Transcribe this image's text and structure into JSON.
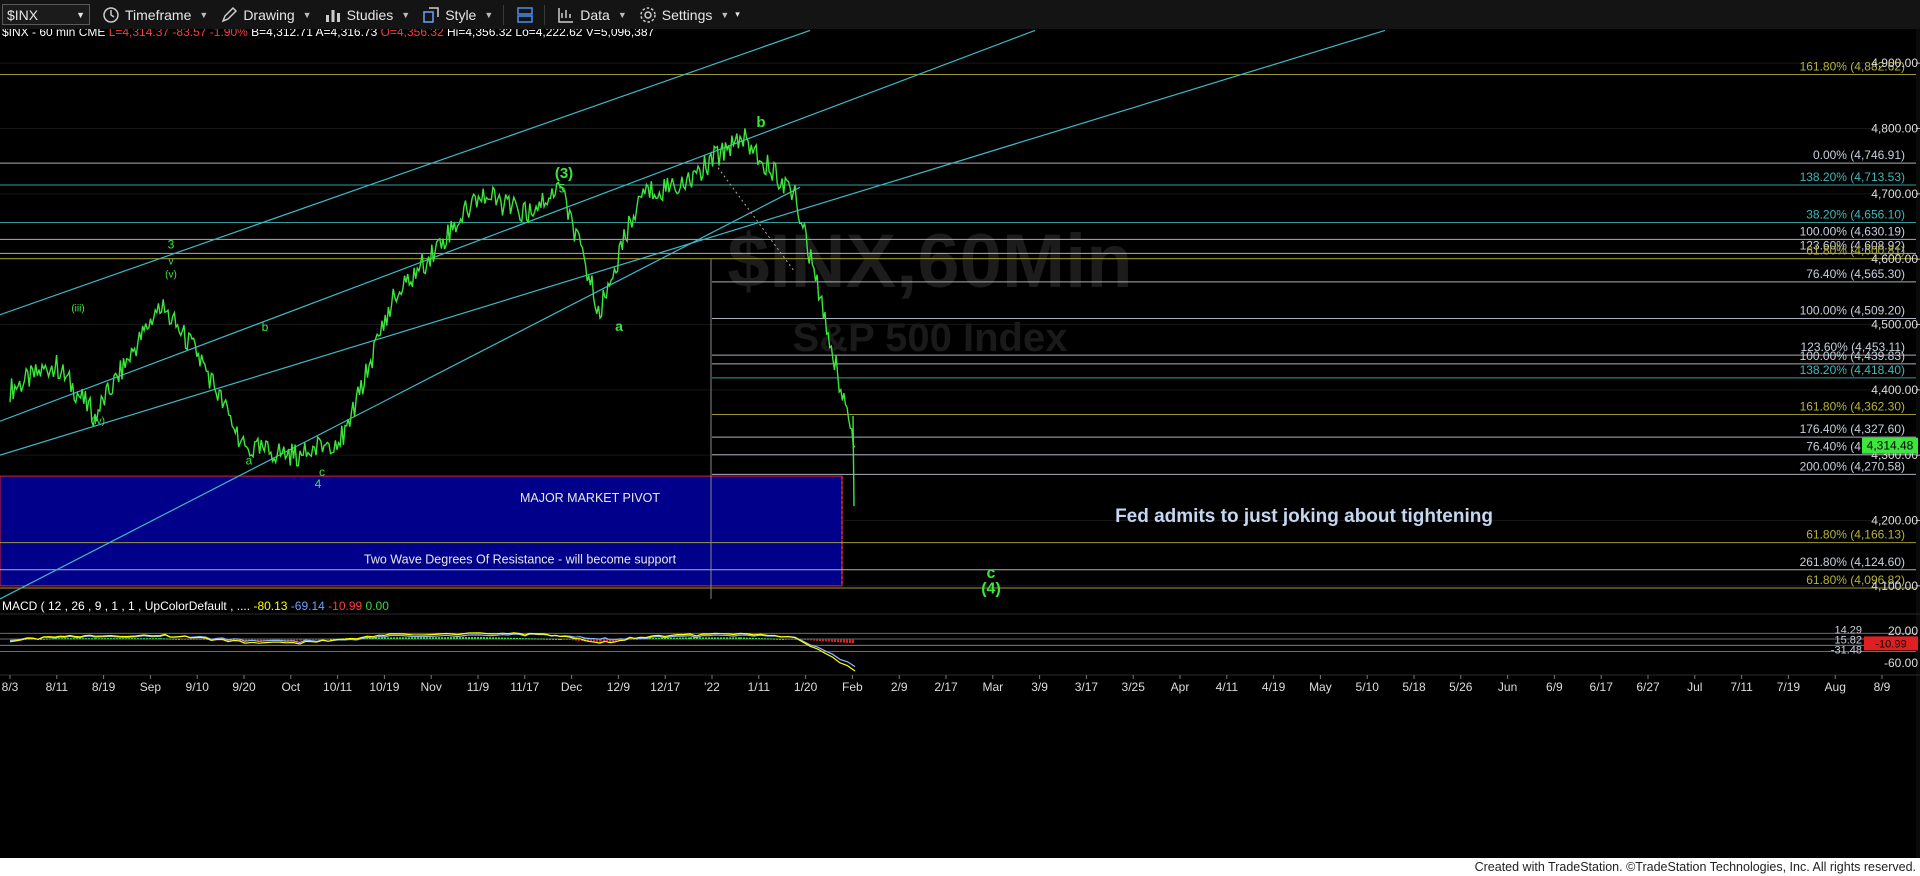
{
  "toolbar": {
    "symbol": "$INX",
    "timeframe_label": "Timeframe",
    "drawing_label": "Drawing",
    "studies_label": "Studies",
    "style_label": "Style",
    "data_label": "Data",
    "settings_label": "Settings"
  },
  "header_line": {
    "parts": [
      {
        "text": "$INX - 60 min  CME",
        "color": "#ffffff"
      },
      {
        "text": "L=4,314.37",
        "color": "#ff3b3b"
      },
      {
        "text": "-83.57",
        "color": "#ff3b3b"
      },
      {
        "text": "-1.90%",
        "color": "#ff3b3b"
      },
      {
        "text": "B=4,312.71",
        "color": "#ffffff"
      },
      {
        "text": "A=4,316.73",
        "color": "#ffffff"
      },
      {
        "text": "O=4,356.32",
        "color": "#ff3b3b"
      },
      {
        "text": "Hi=4,356.32",
        "color": "#ffffff"
      },
      {
        "text": "Lo=4,222.62",
        "color": "#ffffff"
      },
      {
        "text": "V=5,096,387",
        "color": "#ffffff"
      }
    ]
  },
  "watermark": {
    "symbol": "$INX,60Min",
    "name": "S&P 500 Index"
  },
  "annotation": "Fed admits to just joking about tightening",
  "pivot_box": {
    "title": "MAJOR MARKET PIVOT",
    "subtitle": "Two Wave Degrees Of Resistance - will become support"
  },
  "macd_header": {
    "parts": [
      {
        "text": "MACD ( 12 , 26 , 9 , 1 , 1 , UpColorDefault , ....",
        "color": "#ffffff"
      },
      {
        "text": "-80.13",
        "color": "#ffff00"
      },
      {
        "text": "-69.14",
        "color": "#6aa0ff"
      },
      {
        "text": "-10.99",
        "color": "#ff3b3b"
      },
      {
        "text": "0.00",
        "color": "#39d839"
      }
    ]
  },
  "footer": "Created with TradeStation. ©TradeStation Technologies, Inc. All rights reserved.",
  "chart_data": {
    "type": "line",
    "price_axis": {
      "range": [
        4060,
        4940
      ],
      "ticks": [
        4100,
        4200,
        4300,
        4400,
        4500,
        4600,
        4700,
        4800,
        4900
      ],
      "tick_labels": [
        "4,100.00",
        "4,200.00",
        "4,300.00",
        "4,400.00",
        "4,500.00",
        "4,600.00",
        "4,700.00",
        "4,800.00",
        "4,900.00"
      ]
    },
    "last_price": "4,314.48",
    "time_axis_labels": [
      "8/3",
      "8/11",
      "8/19",
      "Sep",
      "9/10",
      "9/20",
      "Oct",
      "10/11",
      "10/19",
      "Nov",
      "11/9",
      "11/17",
      "Dec",
      "12/9",
      "12/17",
      "'22",
      "1/11",
      "1/20",
      "Feb",
      "2/9",
      "2/17",
      "Mar",
      "3/9",
      "3/17",
      "3/25",
      "Apr",
      "4/11",
      "4/19",
      "May",
      "5/10",
      "5/18",
      "5/26",
      "Jun",
      "6/9",
      "6/17",
      "6/27",
      "Jul",
      "7/11",
      "7/19",
      "Aug",
      "8/9"
    ],
    "series": [
      {
        "name": "$INX",
        "x": [
          "8/3",
          "8/11",
          "8/19",
          "Sep",
          "9/10",
          "9/20",
          "Oct",
          "10/11",
          "10/19",
          "Nov",
          "11/9",
          "11/17",
          "Dec",
          "12/9",
          "12/17",
          "'22",
          "1/11",
          "1/20"
        ],
        "values": [
          4400,
          4440,
          4360,
          4530,
          4450,
          4310,
          4300,
          4330,
          4530,
          4700,
          4670,
          4710,
          4520,
          4700,
          4720,
          4790,
          4700,
          4314
        ]
      }
    ],
    "fib_levels": [
      {
        "label": "161.80% (4,882.62)",
        "value": 4882.62,
        "color": "#b8b33a"
      },
      {
        "label": "0.00% (4,746.91)",
        "value": 4746.91,
        "color": "#c8d0dc"
      },
      {
        "label": "138.20% (4,713.53)",
        "value": 4713.53,
        "color": "#3fb8b8"
      },
      {
        "label": "38.20% (4,656.10)",
        "value": 4656.1,
        "color": "#3fb8b8"
      },
      {
        "label": "100.00% (4,630.19)",
        "value": 4630.19,
        "color": "#c8d0dc"
      },
      {
        "label": "123.60% (4,608.92)",
        "value": 4608.92,
        "color": "#c8d0dc"
      },
      {
        "label": "61.80% (4,600.81)",
        "value": 4600.81,
        "color": "#b8b33a"
      },
      {
        "label": "76.40% (4,565.30)",
        "value": 4565.3,
        "color": "#c8d0dc"
      },
      {
        "label": "100.00% (4,509.20)",
        "value": 4509.2,
        "color": "#c8d0dc"
      },
      {
        "label": "123.60% (4,453.11)",
        "value": 4453.11,
        "color": "#c8d0dc"
      },
      {
        "label": "100.00% (4,439.83)",
        "value": 4439.83,
        "color": "#c8d0dc"
      },
      {
        "label": "138.20% (4,418.40)",
        "value": 4418.4,
        "color": "#3fb8b8"
      },
      {
        "label": "161.80% (4,362.30)",
        "value": 4362.3,
        "color": "#b8b33a"
      },
      {
        "label": "176.40% (4,327.60)",
        "value": 4327.6,
        "color": "#c8d0dc"
      },
      {
        "label": "76.40% (4,300.68)",
        "value": 4300.68,
        "color": "#c8d0dc"
      },
      {
        "label": "200.00% (4,270.58)",
        "value": 4270.58,
        "color": "#c8d0dc"
      },
      {
        "label": "61.80% (4,166.13)",
        "value": 4166.13,
        "color": "#b8b33a"
      },
      {
        "label": "261.80% (4,124.60)",
        "value": 4124.6,
        "color": "#c8d0dc"
      },
      {
        "label": "61.80% (4,096.82)",
        "value": 4096.82,
        "color": "#b8b33a"
      }
    ],
    "wave_labels": [
      "(iii)",
      "(iv)",
      "3",
      "v",
      "(v)",
      "a",
      "b",
      "c",
      "4",
      "(3)",
      "5",
      "a",
      "b",
      "c",
      "(4)"
    ],
    "macd": {
      "tick_labels": [
        "20.00",
        "-60.00"
      ],
      "right_values": [
        {
          "text": "14.29",
          "color": "#c8d0dc"
        },
        {
          "text": "15.82",
          "color": "#c8d0dc"
        },
        {
          "text": "-31.48",
          "color": "#c8d0dc"
        },
        {
          "text": "-10.99",
          "color": "#ff3b3b"
        }
      ],
      "macd_line": [
        -5,
        5,
        8,
        10,
        2,
        -8,
        -10,
        0,
        10,
        15,
        12,
        8,
        -10,
        5,
        10,
        12,
        5,
        -80
      ],
      "signal_line": [
        -2,
        3,
        6,
        8,
        4,
        -3,
        -6,
        -2,
        6,
        10,
        10,
        8,
        0,
        3,
        6,
        8,
        6,
        -69
      ],
      "histogram": [
        -3,
        2,
        2,
        2,
        -2,
        -5,
        -4,
        2,
        4,
        5,
        2,
        0,
        -10,
        2,
        4,
        4,
        -1,
        -11
      ]
    }
  }
}
